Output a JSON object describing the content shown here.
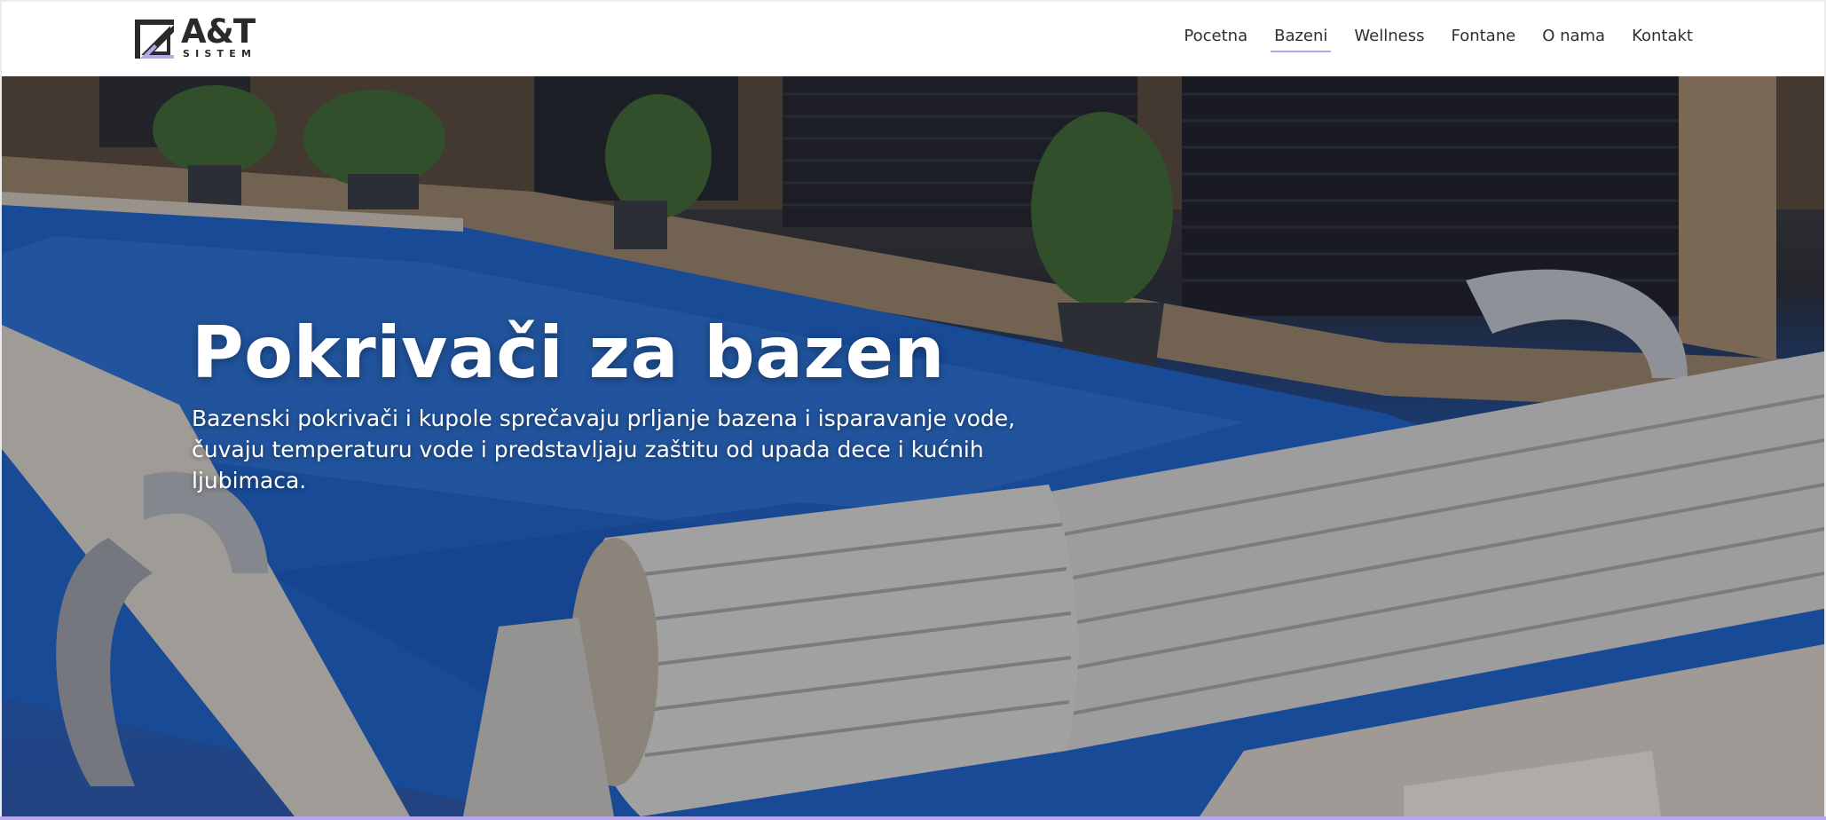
{
  "brand": {
    "name": "A&T",
    "tagline": "SISTEM",
    "logo_icon": "at-sistem-logo-icon"
  },
  "nav": {
    "items": [
      {
        "label": "Pocetna",
        "active": false
      },
      {
        "label": "Bazeni",
        "active": true
      },
      {
        "label": "Wellness",
        "active": false
      },
      {
        "label": "Fontane",
        "active": false
      },
      {
        "label": "O nama",
        "active": false
      },
      {
        "label": "Kontakt",
        "active": false
      }
    ]
  },
  "hero": {
    "title": "Pokrivači za bazen",
    "text": "Bazenski pokrivači i kupole sprečavaju prljanje bazena i isparavanje vode, čuvaju temperaturu vode i predstavljaju zaštitu od upada dece i kućnih ljubimaca.",
    "image": "pool-with-slatted-cover-image"
  },
  "colors": {
    "accent": "#b6a6e8",
    "text_dark": "#2f2f2f",
    "hero_text": "#ffffff",
    "pool_blue": "#1f5fc4"
  }
}
